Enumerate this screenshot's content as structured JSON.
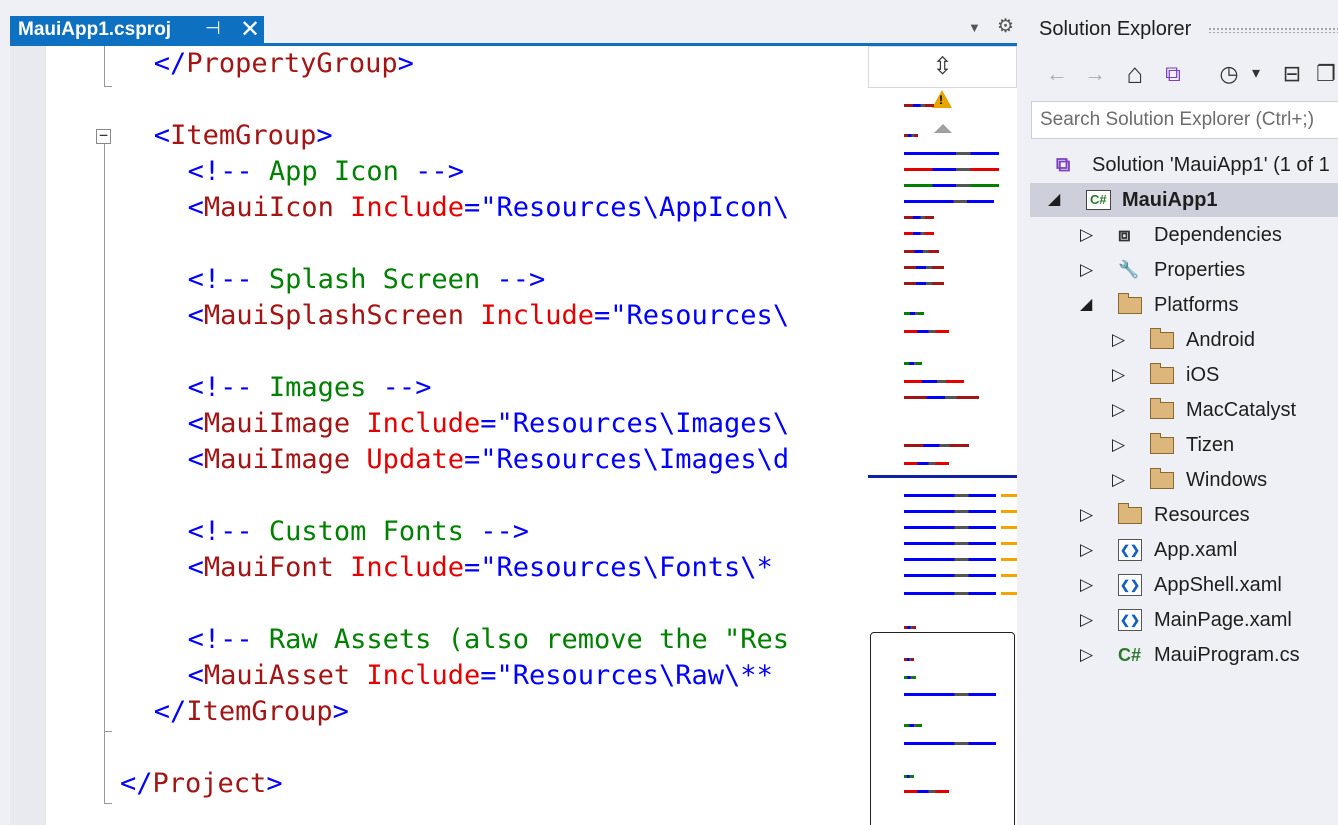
{
  "tab": {
    "title": "MauiApp1.csproj",
    "pin_icon": "⊣",
    "close_icon": "✕"
  },
  "editor": {
    "lines": [
      [
        [
          "p",
          "</"
        ],
        [
          "t",
          "PropertyGroup"
        ],
        [
          "p",
          ">"
        ]
      ],
      [],
      [
        [
          "p",
          "<"
        ],
        [
          "t",
          "ItemGroup"
        ],
        [
          "p",
          ">"
        ]
      ],
      [
        [
          "p",
          "<!-- "
        ],
        [
          "c",
          "App Icon"
        ],
        [
          "p",
          " -->"
        ]
      ],
      [
        [
          "p",
          "<"
        ],
        [
          "t",
          "MauiIcon"
        ],
        [
          "a",
          " Include"
        ],
        [
          "p",
          "=\""
        ],
        [
          "v",
          "Resources\\AppIcon\\"
        ]
      ],
      [],
      [
        [
          "p",
          "<!-- "
        ],
        [
          "c",
          "Splash Screen"
        ],
        [
          "p",
          " -->"
        ]
      ],
      [
        [
          "p",
          "<"
        ],
        [
          "t",
          "MauiSplashScreen"
        ],
        [
          "a",
          " Include"
        ],
        [
          "p",
          "=\""
        ],
        [
          "v",
          "Resources\\"
        ]
      ],
      [],
      [
        [
          "p",
          "<!-- "
        ],
        [
          "c",
          "Images"
        ],
        [
          "p",
          " -->"
        ]
      ],
      [
        [
          "p",
          "<"
        ],
        [
          "t",
          "MauiImage"
        ],
        [
          "a",
          " Include"
        ],
        [
          "p",
          "=\""
        ],
        [
          "v",
          "Resources\\Images\\"
        ]
      ],
      [
        [
          "p",
          "<"
        ],
        [
          "t",
          "MauiImage"
        ],
        [
          "a",
          " Update"
        ],
        [
          "p",
          "=\""
        ],
        [
          "v",
          "Resources\\Images\\d"
        ]
      ],
      [],
      [
        [
          "p",
          "<!-- "
        ],
        [
          "c",
          "Custom Fonts"
        ],
        [
          "p",
          " -->"
        ]
      ],
      [
        [
          "p",
          "<"
        ],
        [
          "t",
          "MauiFont"
        ],
        [
          "a",
          " Include"
        ],
        [
          "p",
          "=\""
        ],
        [
          "v",
          "Resources\\Fonts\\* "
        ]
      ],
      [],
      [
        [
          "p",
          "<!-- "
        ],
        [
          "c",
          "Raw Assets (also remove the \"Res"
        ]
      ],
      [
        [
          "p",
          "<"
        ],
        [
          "t",
          "MauiAsset"
        ],
        [
          "a",
          " Include"
        ],
        [
          "p",
          "=\""
        ],
        [
          "v",
          "Resources\\Raw\\** "
        ]
      ],
      [
        [
          "p",
          "</"
        ],
        [
          "t",
          "ItemGroup"
        ],
        [
          "p",
          ">"
        ]
      ],
      [],
      [
        [
          "p",
          "</"
        ],
        [
          "t",
          "Project"
        ],
        [
          "p",
          ">"
        ]
      ]
    ],
    "indents": [
      2,
      0,
      2,
      4,
      4,
      0,
      4,
      4,
      0,
      4,
      4,
      4,
      0,
      4,
      4,
      0,
      4,
      4,
      2,
      0,
      0
    ]
  },
  "solution_explorer": {
    "title": "Solution Explorer",
    "search_placeholder": "Search Solution Explorer (Ctrl+;)",
    "toolbar": {
      "back_icon": "←",
      "forward_icon": "→",
      "home_icon": "⌂",
      "vs_icon": "⧉",
      "history_icon": "◷",
      "dropdown_icon": "▾",
      "collapse_icon": "⊟",
      "views_icon": "❐"
    },
    "tree": [
      {
        "label": "Solution 'MauiApp1' (1 of 1",
        "level": 0,
        "arrow": "",
        "icon": "solution"
      },
      {
        "label": "MauiApp1",
        "level": 0,
        "arrow": "expanded",
        "icon": "csproj",
        "selected": true
      },
      {
        "label": "Dependencies",
        "level": 1,
        "arrow": "collapsed",
        "icon": "dependencies"
      },
      {
        "label": "Properties",
        "level": 1,
        "arrow": "collapsed",
        "icon": "properties"
      },
      {
        "label": "Platforms",
        "level": 1,
        "arrow": "expanded",
        "icon": "folder"
      },
      {
        "label": "Android",
        "level": 2,
        "arrow": "collapsed",
        "icon": "folder"
      },
      {
        "label": "iOS",
        "level": 2,
        "arrow": "collapsed",
        "icon": "folder"
      },
      {
        "label": "MacCatalyst",
        "level": 2,
        "arrow": "collapsed",
        "icon": "folder"
      },
      {
        "label": "Tizen",
        "level": 2,
        "arrow": "collapsed",
        "icon": "folder"
      },
      {
        "label": "Windows",
        "level": 2,
        "arrow": "collapsed",
        "icon": "folder"
      },
      {
        "label": "Resources",
        "level": 1,
        "arrow": "collapsed",
        "icon": "folder"
      },
      {
        "label": "App.xaml",
        "level": 1,
        "arrow": "collapsed",
        "icon": "xaml"
      },
      {
        "label": "AppShell.xaml",
        "level": 1,
        "arrow": "collapsed",
        "icon": "xaml"
      },
      {
        "label": "MainPage.xaml",
        "level": 1,
        "arrow": "collapsed",
        "icon": "xaml"
      },
      {
        "label": "MauiProgram.cs",
        "level": 1,
        "arrow": "collapsed",
        "icon": "cs"
      }
    ]
  },
  "colors": {
    "accent": "#0e70c0",
    "xml_punct": "#0000ff",
    "xml_tag": "#a31515",
    "xml_attr": "#e50000",
    "xml_comment": "#008000",
    "folder": "#dcb67a"
  }
}
